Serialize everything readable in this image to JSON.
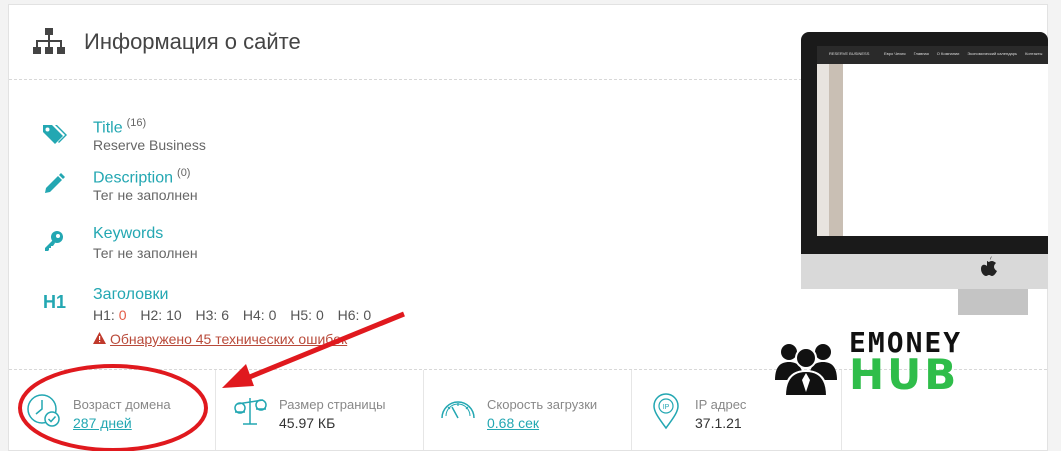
{
  "header": {
    "title": "Информация о сайте",
    "icon": "sitemap-icon"
  },
  "meta": [
    {
      "label": "Title",
      "count": "(16)",
      "value": "Reserve Business",
      "icon": "tag-icon"
    },
    {
      "label": "Description",
      "count": "(0)",
      "value": "Тег не заполнен",
      "icon": "pencil-icon"
    },
    {
      "label": "Keywords",
      "count": "",
      "value": "Тег не заполнен",
      "icon": "key-icon"
    }
  ],
  "headings": {
    "label": "Заголовки",
    "icon_text": "H1",
    "items": [
      {
        "name": "H1:",
        "value": "0"
      },
      {
        "name": "H2:",
        "value": "10"
      },
      {
        "name": "H3:",
        "value": "6"
      },
      {
        "name": "H4:",
        "value": "0"
      },
      {
        "name": "H5:",
        "value": "0"
      },
      {
        "name": "H6:",
        "value": "0"
      }
    ],
    "error_text": "Обнаружено 45 технических ошибок"
  },
  "stats": [
    {
      "label": "Возраст домена",
      "value": "287 дней",
      "icon": "clock-check-icon"
    },
    {
      "label": "Размер страницы",
      "value": "45.97 КБ",
      "icon": "scales-icon"
    },
    {
      "label": "Скорость загрузки",
      "value": "0.68 сек",
      "icon": "speedometer-icon"
    },
    {
      "label": "IP адрес",
      "value": "37.1.21",
      "icon": "map-pin-ip-icon"
    }
  ],
  "preview": {
    "site_name": "RESERVE BUSINESS",
    "nav": [
      "Евро Чехия",
      "Главная",
      "О Компании",
      "Экономический календарь",
      "Контакты"
    ]
  },
  "watermark": {
    "line1": "EMONEY",
    "line2": "HUB"
  },
  "colors": {
    "accent": "#23a7b2",
    "error": "#c0392b",
    "annotation": "#e0191e",
    "logo_green": "#2fbd4a"
  }
}
